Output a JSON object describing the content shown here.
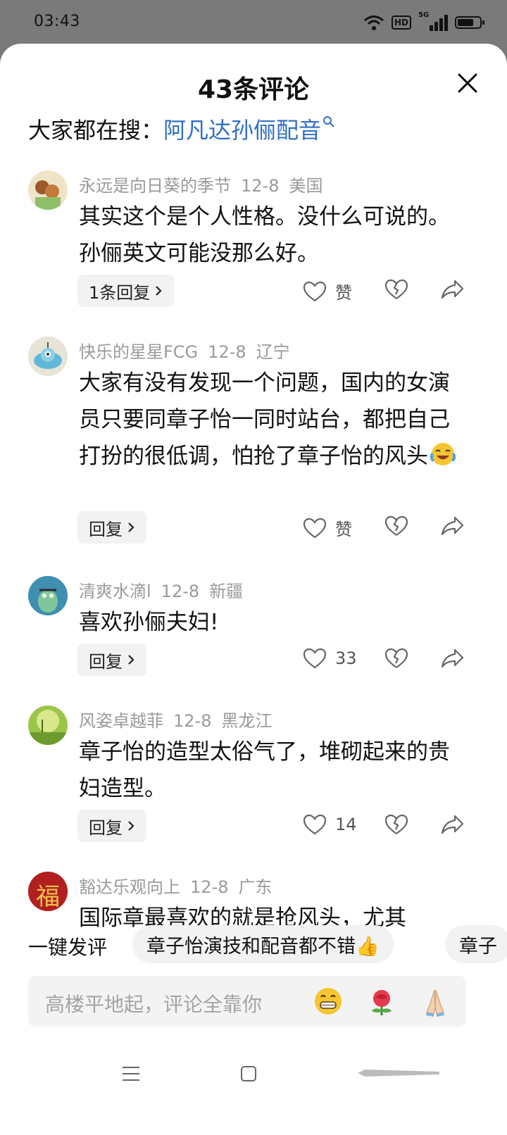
{
  "status_bar": {
    "time": "03:43",
    "hd": "HD",
    "network": "5G"
  },
  "sheet": {
    "title": "43条评论",
    "search_prefix": "大家都在搜：",
    "search_term": "阿凡达孙俪配音"
  },
  "comments": [
    {
      "username": "永远是向日葵的季节",
      "date": "12-8",
      "location": "美国",
      "text": "其实这个是个人性格。没什么可说的。 孙俪英文可能没那么好。",
      "reply_label": "1条回复",
      "like_label": "赞"
    },
    {
      "username": "快乐的星星FCG",
      "date": "12-8",
      "location": "辽宁",
      "text": "大家有没有发现一个问题，国内的女演员只要同章子怡一同时站台，都把自己打扮的很低调，怕抢了章子怡的风头",
      "reply_label": "回复",
      "like_label": "赞"
    },
    {
      "username": "清爽水滴l",
      "date": "12-8",
      "location": "新疆",
      "text": "喜欢孙俪夫妇!",
      "reply_label": "回复",
      "like_label": "33"
    },
    {
      "username": "风姿卓越菲",
      "date": "12-8",
      "location": "黑龙江",
      "text": "章子怡的造型太俗气了，堆砌起来的贵妇造型。",
      "reply_label": "回复",
      "like_label": "14"
    },
    {
      "username": "豁达乐观向上",
      "date": "12-8",
      "location": "广东",
      "text": "国际章最喜欢的就是抢风头，尤其",
      "avatar_char": "福"
    }
  ],
  "quick_comment": {
    "label": "一键发评",
    "chips": [
      "章子怡演技和配音都不错👍",
      "章子"
    ]
  },
  "input": {
    "placeholder": "高楼平地起，评论全靠你"
  },
  "emoji_buttons": [
    "grin-emoji-icon",
    "rose-emoji-icon",
    "pray-emoji-icon"
  ]
}
